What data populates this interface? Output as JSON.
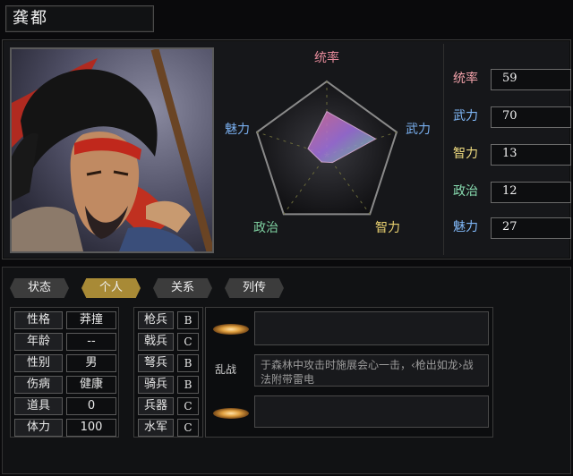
{
  "officer": {
    "name": "龚都"
  },
  "radar": {
    "labels": {
      "lead": "统率",
      "war": "武力",
      "int": "智力",
      "pol": "政治",
      "chr": "魅力"
    },
    "colors": {
      "lead": "#e58a9a",
      "war": "#7ab0f0",
      "int": "#e8d070",
      "pol": "#7ed0a0",
      "chr": "#7ab0f0"
    },
    "max": 100
  },
  "stats": [
    {
      "label": "统率",
      "value": 59,
      "color": "#f0a0a8"
    },
    {
      "label": "武力",
      "value": 70,
      "color": "#80b8f8"
    },
    {
      "label": "智力",
      "value": 13,
      "color": "#f0dc80"
    },
    {
      "label": "政治",
      "value": 12,
      "color": "#88dcb0"
    },
    {
      "label": "魅力",
      "value": 27,
      "color": "#80b8f8"
    }
  ],
  "tabs": [
    "状态",
    "个人",
    "关系",
    "列传"
  ],
  "active_tab": "个人",
  "personal": [
    {
      "label": "性格",
      "value": "莽撞"
    },
    {
      "label": "年龄",
      "value": "--"
    },
    {
      "label": "性别",
      "value": "男"
    },
    {
      "label": "伤病",
      "value": "健康"
    },
    {
      "label": "道具",
      "value": "0"
    },
    {
      "label": "体力",
      "value": "100"
    }
  ],
  "troops": [
    {
      "label": "枪兵",
      "value": "B"
    },
    {
      "label": "戟兵",
      "value": "C"
    },
    {
      "label": "弩兵",
      "value": "B"
    },
    {
      "label": "骑兵",
      "value": "B"
    },
    {
      "label": "兵器",
      "value": "C"
    },
    {
      "label": "水军",
      "value": "C"
    }
  ],
  "skills": [
    {
      "name": "",
      "desc": ""
    },
    {
      "name": "乱战",
      "desc": "于森林中攻击时施展会心一击，‹枪出如龙›战法附带雷电"
    },
    {
      "name": "",
      "desc": ""
    }
  ]
}
